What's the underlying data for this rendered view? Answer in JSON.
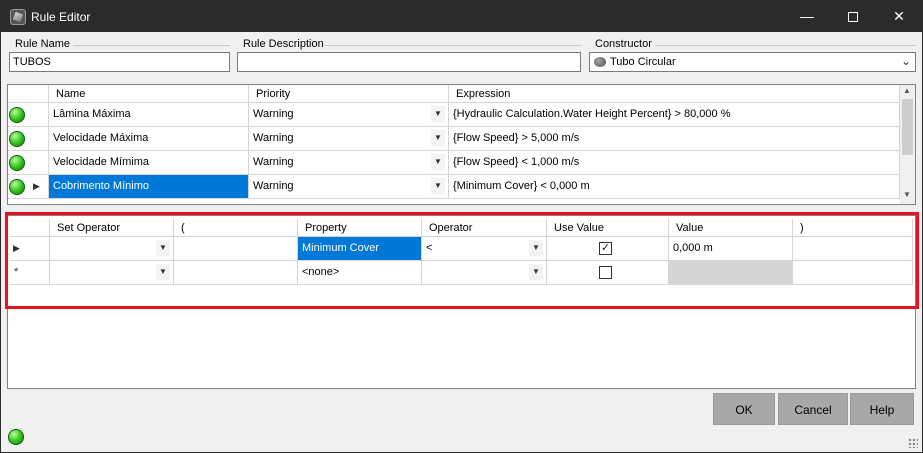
{
  "window": {
    "title": "Rule Editor",
    "controls": {
      "minimize": "—",
      "close": "✕"
    }
  },
  "fields": {
    "rule_name_label": "Rule Name",
    "rule_name_value": "TUBOS",
    "rule_description_label": "Rule Description",
    "rule_description_value": "",
    "constructor_label": "Constructor",
    "constructor_value": "Tubo Circular"
  },
  "rules_grid": {
    "columns": [
      "Name",
      "Priority",
      "Expression"
    ],
    "rows": [
      {
        "name": "Lâmina Máxima",
        "priority": "Warning",
        "expression": "{Hydraulic Calculation.Water Height Percent} > 80,000 %"
      },
      {
        "name": "Velocidade Máxima",
        "priority": "Warning",
        "expression": "{Flow Speed} > 5,000 m/s"
      },
      {
        "name": "Velocidade Mímima",
        "priority": "Warning",
        "expression": "{Flow Speed} < 1,000 m/s"
      },
      {
        "name": "Cobrimento Mínimo",
        "priority": "Warning",
        "expression": "{Minimum Cover} < 0,000 m"
      }
    ]
  },
  "conditions_grid": {
    "columns": [
      "Set Operator",
      "(",
      "Property",
      "Operator",
      "Use Value",
      "Value",
      ")"
    ],
    "rows": [
      {
        "set_operator": "",
        "open_paren": "",
        "property": "Minimum Cover",
        "operator": "<",
        "use_value": true,
        "value": "0,000 m",
        "close_paren": ""
      },
      {
        "set_operator": "",
        "open_paren": "",
        "property": "<none>",
        "operator": "",
        "use_value": false,
        "value": "",
        "close_paren": ""
      }
    ]
  },
  "buttons": {
    "ok": "OK",
    "cancel": "Cancel",
    "help": "Help"
  },
  "colors": {
    "selection": "#0078d7",
    "highlight_border": "#e81123",
    "status_ok": "#2fbf19"
  }
}
